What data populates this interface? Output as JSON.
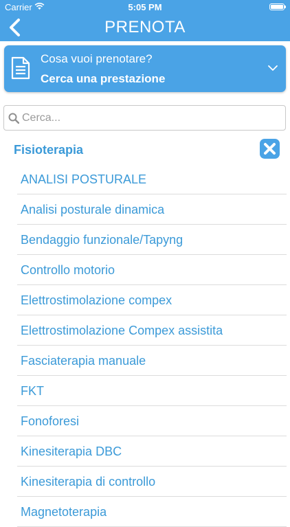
{
  "status_bar": {
    "carrier": "Carrier",
    "time": "5:05 PM"
  },
  "nav": {
    "title": "PRENOTA",
    "back_icon": "chevron-left-icon"
  },
  "service_selector": {
    "question": "Cosa vuoi prenotare?",
    "label": "Cerca una prestazione",
    "icon": "document-icon",
    "expand_icon": "chevron-down-icon"
  },
  "search": {
    "placeholder": "Cerca...",
    "value": ""
  },
  "category": {
    "title": "Fisioterapia",
    "close_icon": "close-icon",
    "items": [
      "ANALISI POSTURALE",
      "Analisi posturale dinamica",
      "Bendaggio funzionale/Tapyng",
      "Controllo motorio",
      "Elettrostimolazione compex",
      "Elettrostimolazione Compex assistita",
      "Fasciaterapia manuale",
      "FKT",
      "Fonoforesi",
      "Kinesiterapia DBC",
      "Kinesiterapia di controllo",
      "Magnetoterapia"
    ]
  },
  "colors": {
    "primary": "#4aa3e6",
    "text_link": "#3b9ad8",
    "divider": "#dcdcdc"
  }
}
